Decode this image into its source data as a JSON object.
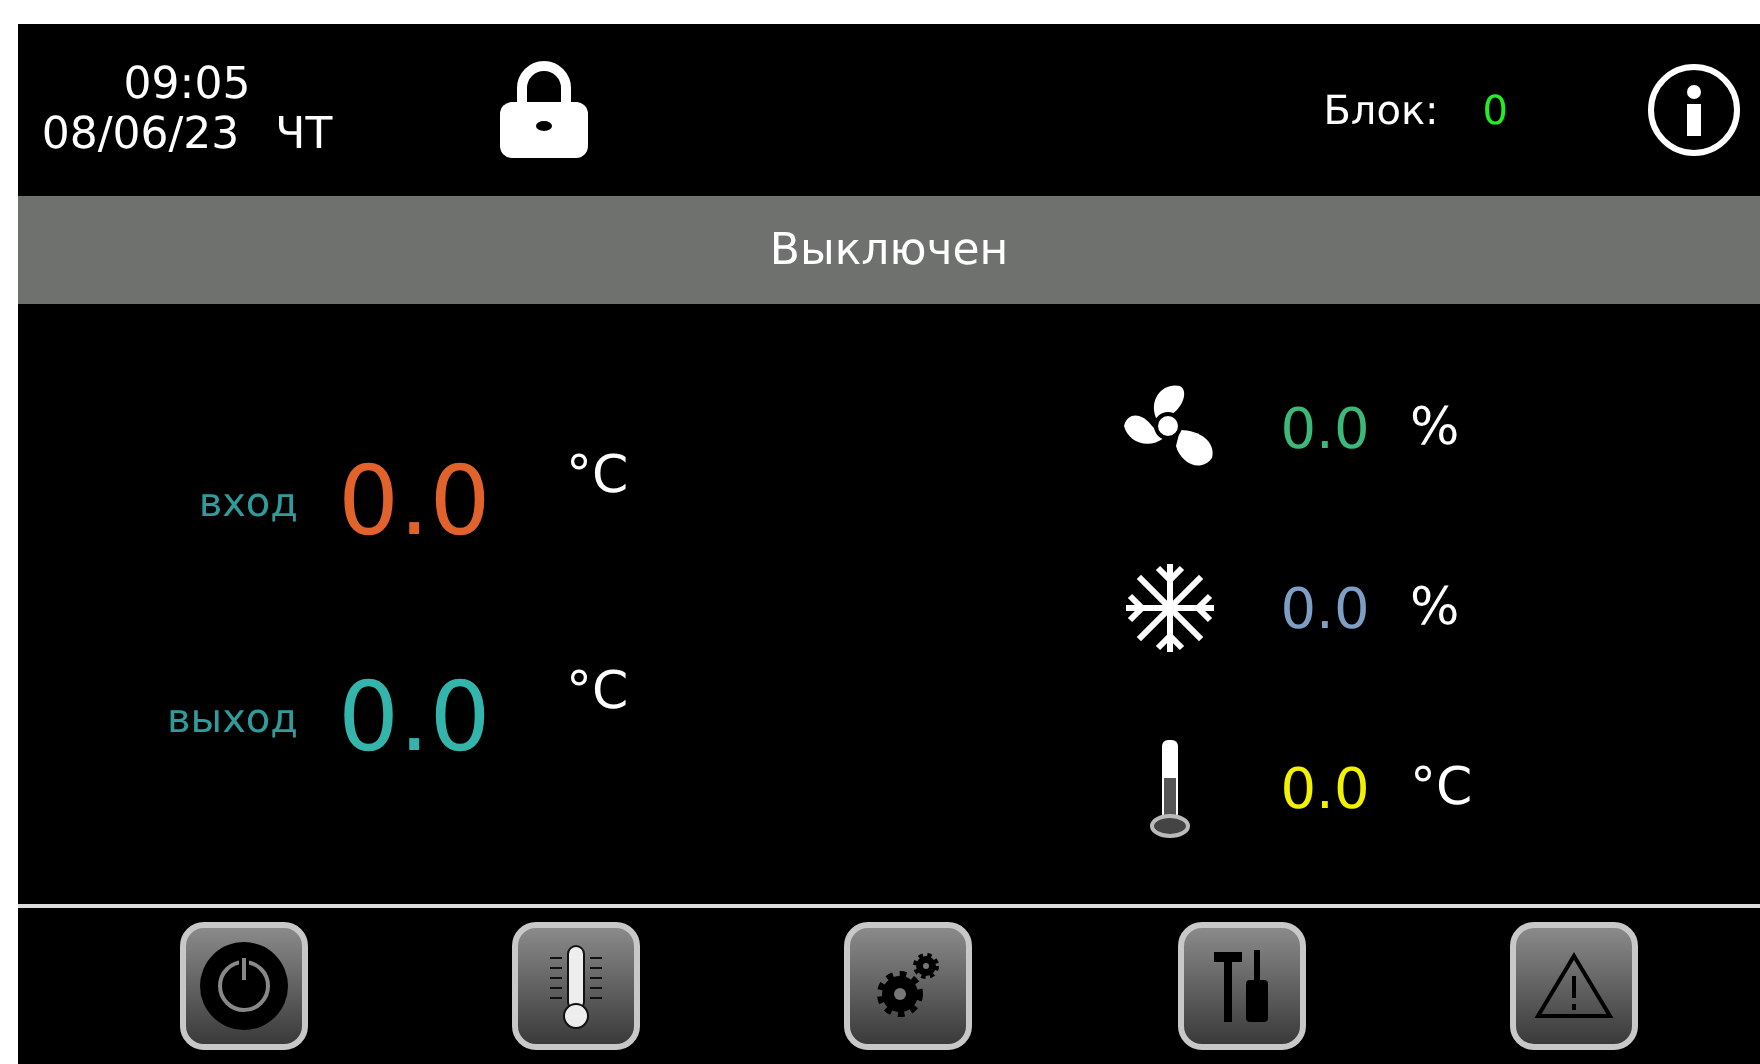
{
  "header": {
    "time": "09:05",
    "date": "08/06/23",
    "weekday": "ЧТ",
    "block_label": "Блок:",
    "block_value": "0"
  },
  "status": "Выключен",
  "temperatures": [
    {
      "label": "вход",
      "value": "0.0",
      "unit": "°C",
      "color": "#e2622c"
    },
    {
      "label": "выход",
      "value": "0.0",
      "unit": "°C",
      "color": "#33b5ab"
    }
  ],
  "readings": [
    {
      "kind": "fan",
      "value": "0.0",
      "unit": "%",
      "color": "#3cb878"
    },
    {
      "kind": "cooling",
      "value": "0.0",
      "unit": "%",
      "color": "#7d9fc6"
    },
    {
      "kind": "temperature",
      "value": "0.0",
      "unit": "°C",
      "color": "#f2f200"
    }
  ],
  "toolbar": [
    {
      "kind": "power"
    },
    {
      "kind": "thermometer"
    },
    {
      "kind": "settings"
    },
    {
      "kind": "tools"
    },
    {
      "kind": "alarm"
    }
  ]
}
